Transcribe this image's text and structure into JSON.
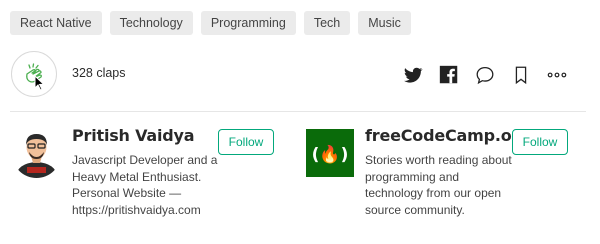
{
  "tags": [
    "React Native",
    "Technology",
    "Programming",
    "Tech",
    "Music"
  ],
  "claps": {
    "count_label": "328 claps",
    "icon": "clap-hands-icon"
  },
  "actions": [
    {
      "name": "twitter-icon",
      "icon": "twitter"
    },
    {
      "name": "facebook-icon",
      "icon": "facebook"
    },
    {
      "name": "comment-icon",
      "icon": "speech-bubble"
    },
    {
      "name": "bookmark-icon",
      "icon": "bookmark"
    },
    {
      "name": "more-icon",
      "icon": "ellipsis"
    }
  ],
  "author": {
    "name": "Pritish Vaidya",
    "bio": "Javascript Developer and a Heavy Metal Enthusiast. Personal Website — https://pritishvaidya.com",
    "follow_label": "Follow"
  },
  "publication": {
    "name": "freeCodeCamp.org",
    "logo_text": "(🔥)",
    "bio": "Stories worth reading about programming and technology from our open source community.",
    "follow_label": "Follow"
  },
  "colors": {
    "accent": "#03a87c",
    "logo_bg": "#0a6b0a",
    "tag_bg": "#ebebeb"
  }
}
